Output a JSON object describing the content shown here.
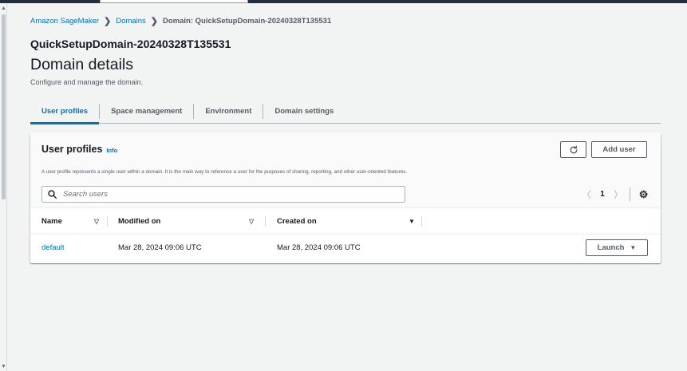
{
  "breadcrumb": {
    "items": [
      "Amazon SageMaker",
      "Domains"
    ],
    "current": "Domain: QuickSetupDomain-20240328T135531",
    "separator": "❯"
  },
  "header": {
    "domain_name": "QuickSetupDomain-20240328T135531",
    "title": "Domain details",
    "description": "Configure and manage the domain."
  },
  "tabs": [
    {
      "label": "User profiles",
      "active": true
    },
    {
      "label": "Space management",
      "active": false
    },
    {
      "label": "Environment",
      "active": false
    },
    {
      "label": "Domain settings",
      "active": false
    }
  ],
  "user_profiles": {
    "title": "User profiles",
    "info_label": "Info",
    "description": "A user profile represents a single user within a domain. It is the main way to reference a user for the purposes of sharing, reporting, and other user-oriented features.",
    "add_user_label": "Add user",
    "search_placeholder": "Search users",
    "pagination": {
      "prev": "〈",
      "page": "1",
      "next": "〉"
    },
    "columns": [
      "Name",
      "Modified on",
      "Created on"
    ],
    "sort_icons": [
      "▽",
      "▽",
      "▼"
    ],
    "rows": [
      {
        "name": "default",
        "modified_on": "Mar 28, 2024 09:06 UTC",
        "created_on": "Mar 28, 2024 09:06 UTC",
        "action": "Launch",
        "action_caret": "▼"
      }
    ]
  },
  "scrollbar": {
    "up": "▲",
    "down": "▼"
  },
  "colors": {
    "accent": "#0073bb",
    "text": "#16191f",
    "muted": "#545b64",
    "page_bg": "#f2f3f3",
    "topbar": "#232f3e"
  },
  "icons": {
    "refresh": "refresh-icon",
    "search": "search-icon",
    "settings": "gear-icon",
    "breadcrumb_separator": "chevron-right-icon",
    "dropdown": "caret-down-icon"
  }
}
